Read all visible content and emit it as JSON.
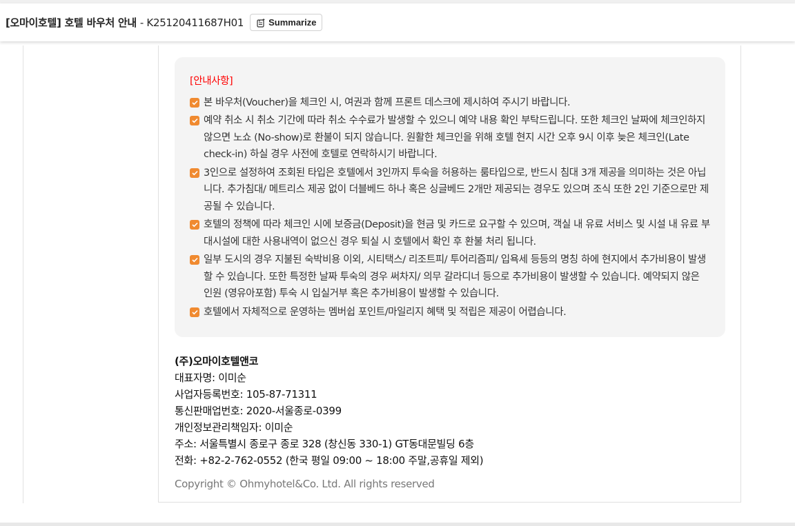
{
  "header": {
    "title": "[오마이호텔] 호텔 바우처 안내",
    "code": "- K25120411687H01",
    "summarize_label": "Summarize"
  },
  "notice": {
    "heading": "[안내사항]",
    "items": [
      "본 바우처(Voucher)을 체크인 시, 여권과 함께 프론트 데스크에 제시하여 주시기 바랍니다.",
      "예약 취소 시 취소 기간에 따라 취소 수수료가 발생할 수 있으니 예약 내용 확인 부탁드립니다. 또한 체크인 날짜에 체크인하지 않으면 노쇼 (No-show)로 환불이 되지 않습니다. 원활한 체크인을 위해 호텔 현지 시간 오후 9시 이후 늦은 체크인(Late check-in) 하실 경우 사전에 호텔로 연락하시기 바랍니다.",
      "3인으로 설정하여 조회된 타입은 호텔에서 3인까지 투숙을 허용하는 룸타입으로, 반드시 침대 3개 제공을 의미하는 것은 아닙니다. 추가침대/ 메트리스 제공 없이 더블베드 하나 혹은 싱글베드 2개만 제공되는 경우도 있으며 조식 또한 2인 기준으로만 제공될 수 있습니다.",
      "호텔의 정책에 따라 체크인 시에 보증금(Deposit)을 현금 및 카드로 요구할 수 있으며, 객실 내 유료 서비스 및 시설 내 유료 부대시설에 대한 사용내역이 없으신 경우 퇴실 시 호텔에서 확인 후 환불 처리 됩니다.",
      "일부 도시의 경우 지불된 숙박비용 이외, 시티택스/ 리조트피/ 투어리즘피/ 입욕세 등등의 명칭 하에 현지에서 추가비용이 발생할 수 있습니다. 또한 특정한 날짜 투숙의 경우 써차지/ 의무 갈라디너 등으로 추가비용이 발생할 수 있습니다. 예약되지 않은 인원 (영유아포함) 투숙 시 입실거부 혹은 추가비용이 발생할 수 있습니다.",
      "호텔에서 자체적으로 운영하는 멤버쉽 포인트/마일리지 혜택 및 적립은 제공이 어렵습니다."
    ]
  },
  "company": {
    "name": "(주)오마이호텔앤코",
    "ceo": "대표자명: 이미순",
    "biz_no": "사업자등록번호: 105-87-71311",
    "ecommerce_no": "통신판매업번호: 2020-서울종로-0399",
    "privacy": "개인정보관리책임자: 이미순",
    "address": "주소: 서울특별시 종로구 종로 328 (창신동 330-1) GT동대문빌딩 6층",
    "phone": "전화: +82-2-762-0552 (한국 평일 09:00 ~ 18:00 주말,공휴일 제외)",
    "copyright": "Copyright © Ohmyhotel&Co. Ltd. All rights reserved"
  }
}
